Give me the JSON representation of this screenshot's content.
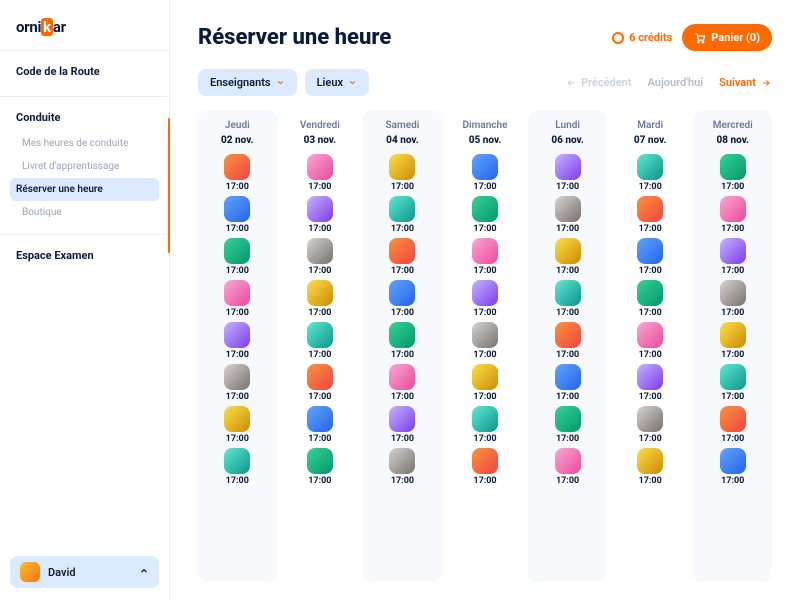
{
  "brand": {
    "pre": "orni",
    "mid": "k",
    "post": "ar"
  },
  "sidebar": {
    "sections": [
      {
        "title": "Code de la Route",
        "items": []
      },
      {
        "title": "Conduite",
        "items": [
          {
            "label": "Mes heures de conduite"
          },
          {
            "label": "Livret d'apprentissage"
          },
          {
            "label": "Réserver une heure"
          },
          {
            "label": "Boutique"
          }
        ],
        "activeIndex": 2
      },
      {
        "title": "Espace Examen",
        "items": []
      }
    ]
  },
  "user": {
    "name": "David"
  },
  "page": {
    "title": "Réserver une heure"
  },
  "credits": {
    "label": "6 crédits"
  },
  "cart": {
    "label": "Panier (0)"
  },
  "filters": {
    "teachers": "Enseignants",
    "places": "Lieux"
  },
  "pager": {
    "prev": "Précédent",
    "today": "Aujourd'hui",
    "next": "Suivant"
  },
  "week": [
    {
      "name": "Jeudi",
      "date": "02 nov."
    },
    {
      "name": "Vendredi",
      "date": "03 nov."
    },
    {
      "name": "Samedi",
      "date": "04 nov."
    },
    {
      "name": "Dimanche",
      "date": "05 nov."
    },
    {
      "name": "Lundi",
      "date": "06 nov."
    },
    {
      "name": "Mardi",
      "date": "07 nov."
    },
    {
      "name": "Mercredi",
      "date": "08 nov."
    }
  ],
  "slotsPerDay": 8,
  "slotTime": "17:00"
}
